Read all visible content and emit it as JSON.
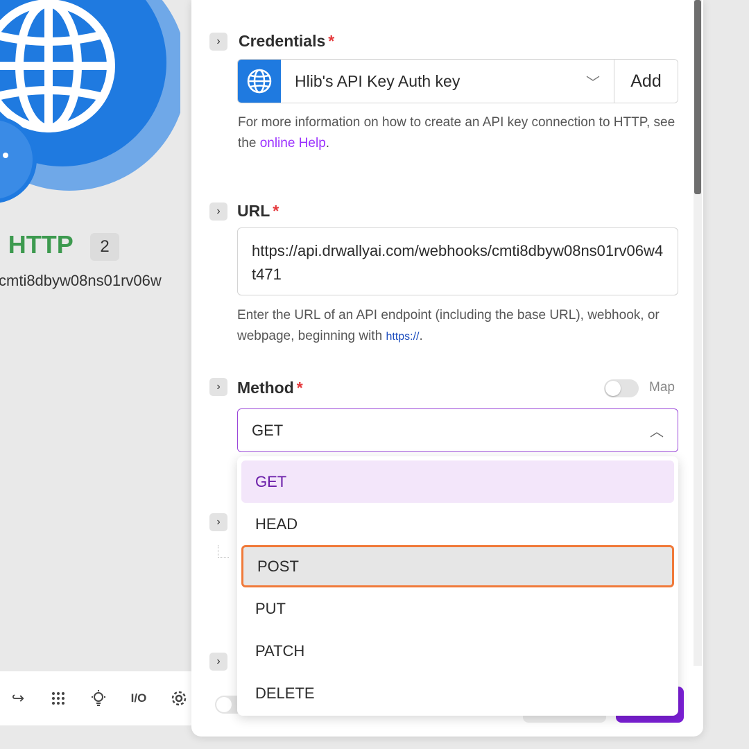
{
  "canvas": {
    "module_title": "HTTP",
    "module_count": "2",
    "module_subtitle": "cmti8dbyw08ns01rv06w",
    "toolbar_icons": [
      "redo-icon",
      "grid-icon",
      "lightbulb-icon",
      "io-icon",
      "settings-icon"
    ],
    "io_label": "I/O"
  },
  "credentials": {
    "label": "Credentials",
    "required_mark": "*",
    "value": "Hlib's API Key Auth key",
    "add_label": "Add",
    "help_prefix": "For more information on how to create an API key connection to HTTP, see the ",
    "help_link": "online Help",
    "help_suffix": "."
  },
  "url": {
    "label": "URL",
    "required_mark": "*",
    "value": "https://api.drwallyai.com/webhooks/cmti8dbyw08ns01rv06w4t471",
    "help_prefix": "Enter the URL of an API endpoint (including the base URL), webhook, or webpage, beginning with ",
    "help_code": "https://",
    "help_suffix": "."
  },
  "method": {
    "label": "Method",
    "required_mark": "*",
    "map_label": "Map",
    "selected_value": "GET",
    "options": [
      "GET",
      "HEAD",
      "POST",
      "PUT",
      "PATCH",
      "DELETE"
    ]
  },
  "colors": {
    "accent": "#7b1fd6",
    "selected_bg": "#f3e6fa",
    "highlight_border": "#f07a3a",
    "module_blue": "#1f7ae0",
    "title_green": "#3d9a4f"
  }
}
